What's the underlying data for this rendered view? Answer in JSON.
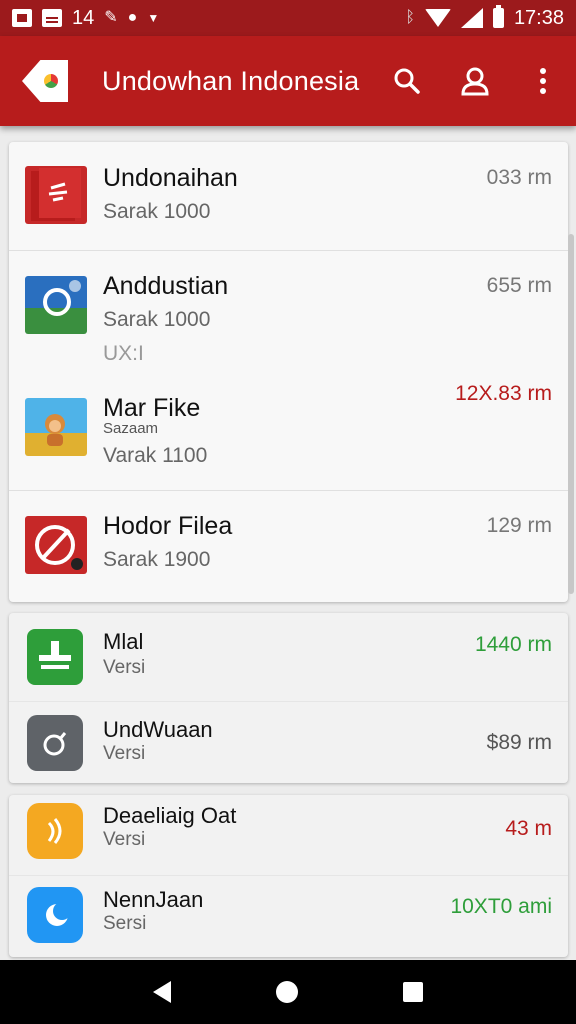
{
  "status_bar": {
    "left_text": "14",
    "time": "17:38",
    "icons": [
      "pdf-notification-icon",
      "news-notification-icon",
      "bird-notification-icon",
      "cloud-notification-icon",
      "caret-down-icon",
      "bluetooth-icon",
      "wifi-icon",
      "signal-icon",
      "battery-icon"
    ]
  },
  "app_bar": {
    "title": "Undowhan Indonesia",
    "actions": [
      "search-icon",
      "account-icon",
      "more-vert-icon"
    ]
  },
  "groups": [
    {
      "items": [
        {
          "title": "Undonaihan",
          "subtitle": "Sarak 1000",
          "size": "033 rm",
          "size_color": "#777777",
          "icon": "red-document-icon"
        },
        {
          "title": "Anddustian",
          "subtitle": "Sarak 1000",
          "extra": "UX:I",
          "size": "655 rm",
          "size_color": "#777777",
          "icon": "blue-landscape-icon"
        },
        {
          "title": "Mar Fike",
          "note": "Sazaam",
          "subtitle": "Varak 1100",
          "size": "12X.83 rm",
          "size_color": "#b71c1c",
          "icon": "cartoon-monkey-icon"
        },
        {
          "title": "Hodor Filea",
          "subtitle": "Sarak 1900",
          "size": "129 rm",
          "size_color": "#777777",
          "icon": "red-no-sign-icon"
        }
      ]
    },
    {
      "items": [
        {
          "title": "Mlal",
          "subtitle": "Versi",
          "size": "1440 rm",
          "size_color": "#2e9e3a",
          "icon": "green-tool-icon"
        },
        {
          "title": "UndWuaan",
          "subtitle": "Versi",
          "size": "$89 rm",
          "size_color": "#555555",
          "icon": "gray-settings-icon"
        }
      ]
    },
    {
      "items": [
        {
          "title": "Deaeliaig Oat",
          "subtitle": "Versi",
          "size": "43 m",
          "size_color": "#b71c1c",
          "icon": "orange-wave-icon"
        },
        {
          "title": "NennJaan",
          "subtitle": "Sersi",
          "size": "10XT0 ami",
          "size_color": "#2e9e3a",
          "icon": "blue-moon-icon"
        }
      ]
    }
  ],
  "nav_bar": {
    "buttons": [
      "back-icon",
      "home-icon",
      "recents-icon"
    ]
  }
}
